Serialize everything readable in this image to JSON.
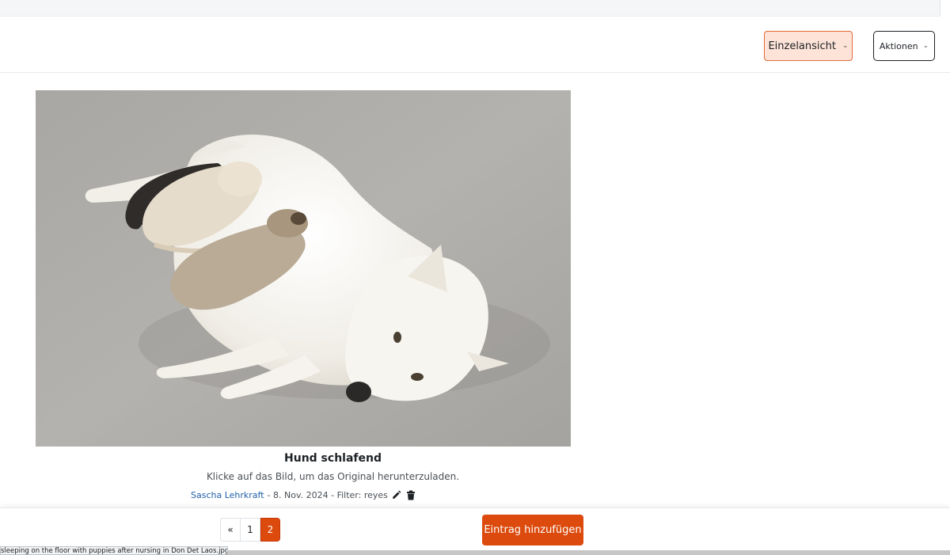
{
  "toolbar": {
    "view_label": "Einzelansicht",
    "actions_label": "Aktionen"
  },
  "entry": {
    "image_alt": "Hund schlafend",
    "title": "Hund schlafend",
    "description": "Klicke auf das Bild, um das Original herunterzuladen.",
    "author": "Sascha Lehrkraft",
    "meta_rest": " - 8. Nov. 2024 - Filter: reyes"
  },
  "pagination": {
    "prev": "«",
    "pages": [
      "1",
      "2"
    ],
    "current": "2"
  },
  "footer": {
    "add_label": "Eintrag hinzufügen"
  },
  "status_bar": {
    "text": "sleeping on the floor with puppies after nursing in Don Det Laos.jpg"
  },
  "colors": {
    "accent": "#dc4a0d",
    "accent_light": "#fde3d8",
    "link": "#1f5fa8"
  }
}
